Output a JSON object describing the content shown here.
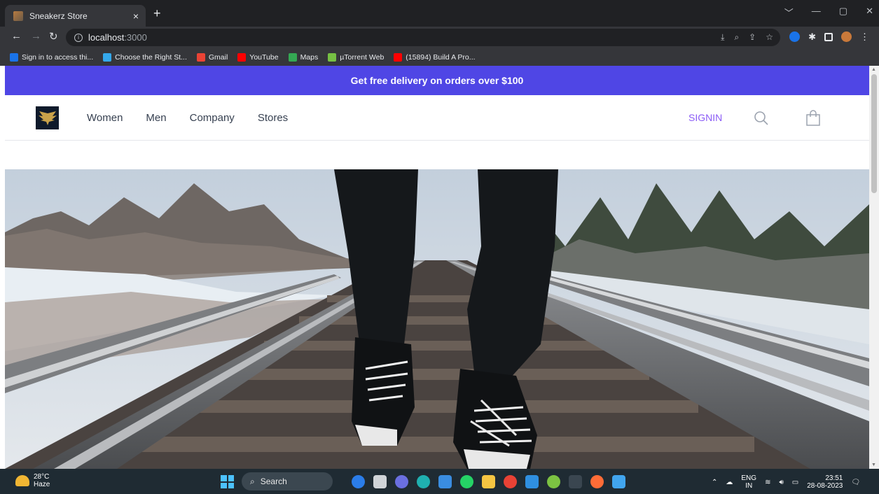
{
  "browser": {
    "tab_title": "Sneakerz Store",
    "tab_close": "×",
    "new_tab": "+",
    "url_host": "localhost",
    "url_port": ":3000",
    "window_controls": [
      "﹀",
      "—",
      "▢",
      "✕"
    ],
    "bookmarks": [
      {
        "label": "Sign in to access thi...",
        "color": "#1a73e8"
      },
      {
        "label": "Choose the Right St...",
        "color": "#34a8eb"
      },
      {
        "label": "Gmail",
        "color": "#ea4335"
      },
      {
        "label": "YouTube",
        "color": "#ff0000"
      },
      {
        "label": "Maps",
        "color": "#34a853"
      },
      {
        "label": "µTorrent Web",
        "color": "#76c043"
      },
      {
        "label": "(15894) Build A Pro...",
        "color": "#ff0000"
      }
    ]
  },
  "site": {
    "promo": "Get free delivery on orders over $100",
    "nav": [
      "Women",
      "Men",
      "Company",
      "Stores"
    ],
    "signin": "SIGNIN",
    "accent": "#4f46e5",
    "signin_color": "#8b5cf6"
  },
  "taskbar": {
    "temp": "28°C",
    "weather": "Haze",
    "search": "Search",
    "lang_top": "ENG",
    "lang_bottom": "IN",
    "time": "23:51",
    "date": "28-08-2023"
  }
}
